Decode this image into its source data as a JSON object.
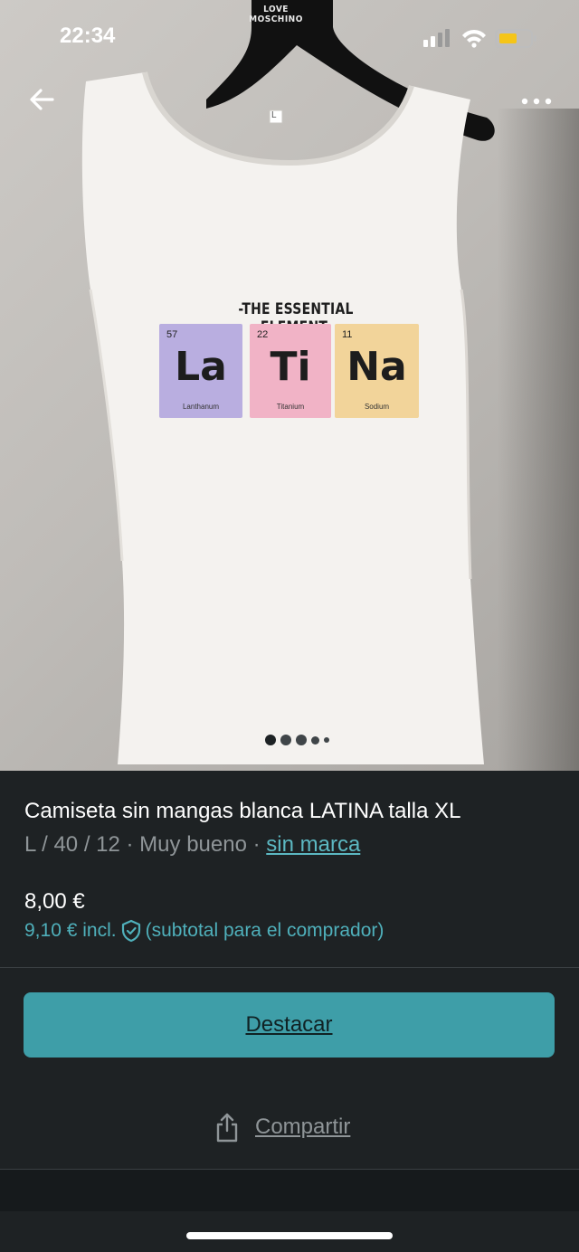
{
  "status_bar": {
    "time": "22:34"
  },
  "photo": {
    "hanger_brand_line1": "LOVE",
    "hanger_brand_line2": "MOSCHINO",
    "shirt_size_tag": "L",
    "print": {
      "title": "-THE ESSENTIAL ELEMENT-",
      "elements": [
        {
          "number": "57",
          "symbol": "La",
          "name": "Lanthanum",
          "color": "#b9aee0"
        },
        {
          "number": "22",
          "symbol": "Ti",
          "name": "Titanium",
          "color": "#f1b3c6"
        },
        {
          "number": "11",
          "symbol": "Na",
          "name": "Sodium",
          "color": "#f2d49a"
        }
      ]
    },
    "carousel_count": 5,
    "carousel_active_index": 0
  },
  "product": {
    "title": "Camiseta sin mangas blanca LATINA talla XL",
    "meta_prefix": "L / 40 / 12 · Muy bueno · ",
    "brand_link": "sin marca",
    "price": "8,00 €",
    "price_incl": "9,10 € incl.",
    "price_incl_note": "(subtotal para el comprador)"
  },
  "actions": {
    "destacar_label": "Destacar",
    "share_label": "Compartir"
  },
  "icons": {
    "back": "arrow-left-icon",
    "more": "more-horizontal-icon",
    "shield": "shield-check-icon",
    "share": "share-icon"
  },
  "colors": {
    "background": "#1e2224",
    "accent": "#3e9ea8",
    "link": "#5cb8c2",
    "muted_text": "#8f9598",
    "battery": "#f5c518"
  }
}
